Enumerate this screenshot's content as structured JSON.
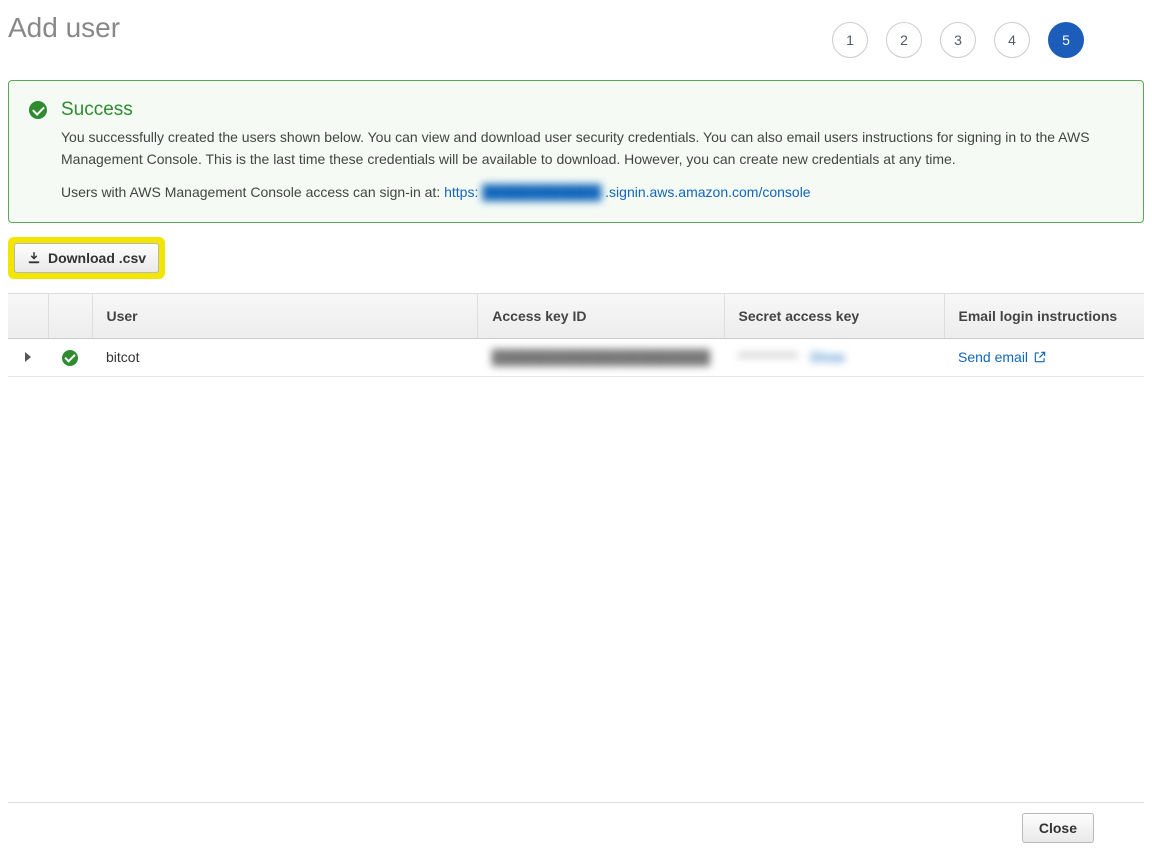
{
  "header": {
    "title": "Add user",
    "steps": [
      "1",
      "2",
      "3",
      "4",
      "5"
    ],
    "active_step_index": 4
  },
  "success": {
    "title": "Success",
    "message": "You successfully created the users shown below. You can view and download user security credentials. You can also email users instructions for signing in to the AWS Management Console. This is the last time these credentials will be available to download. However, you can create new credentials at any time.",
    "signin_prefix": "Users with AWS Management Console access can sign-in at: ",
    "signin_link_protocol": "https:",
    "signin_link_blurred": "████████████",
    "signin_link_suffix": ".signin.aws.amazon.com/console"
  },
  "download": {
    "label": "Download .csv"
  },
  "table": {
    "headers": {
      "user": "User",
      "access_key": "Access key ID",
      "secret": "Secret access key",
      "email": "Email login instructions"
    },
    "rows": [
      {
        "user": "bitcot",
        "access_key_blurred": "██████████████████████",
        "secret_blurred": "***********",
        "secret_show": "Show",
        "email_action": "Send email"
      }
    ]
  },
  "footer": {
    "close": "Close"
  }
}
